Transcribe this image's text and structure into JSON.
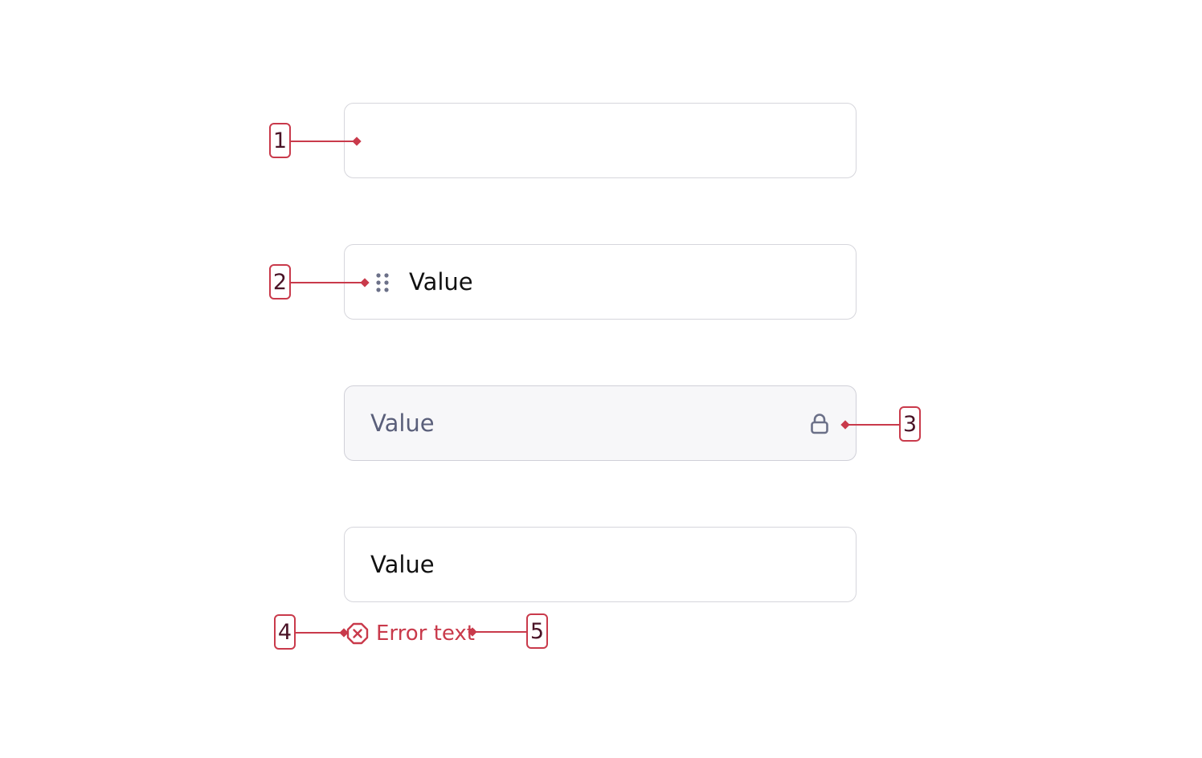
{
  "fields": [
    {
      "id": "empty",
      "value": ""
    },
    {
      "id": "draggable",
      "value": "Value"
    },
    {
      "id": "locked",
      "value": "Value"
    },
    {
      "id": "error",
      "value": "Value"
    }
  ],
  "error_message": "Error text",
  "markers": [
    "1",
    "2",
    "3",
    "4",
    "5"
  ],
  "icons": {
    "drag_handle": "grip-dots-icon",
    "lock": "lock-icon",
    "error": "error-octagon-icon"
  },
  "colors": {
    "annotation": "#c93a4b",
    "marker_text": "#4a1326",
    "field_border": "#d6d6dc",
    "locked_background": "#f7f7f9",
    "locked_text": "#5a5f7a",
    "icon_gray": "#6b7088"
  }
}
